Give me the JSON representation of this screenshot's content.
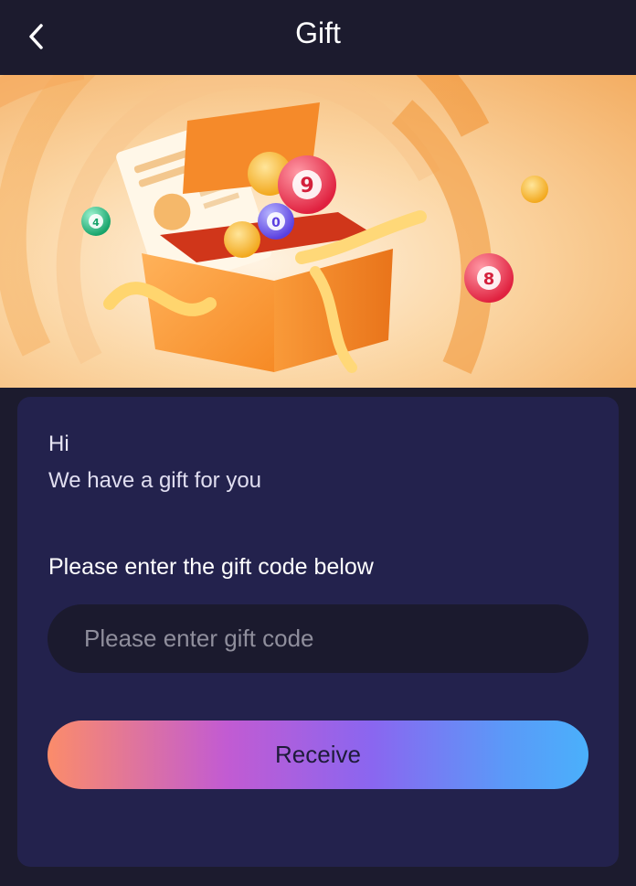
{
  "header": {
    "title": "Gift",
    "back_icon": "chevron-left-icon"
  },
  "banner": {
    "image": "gift-box-banner",
    "balls": [
      "4",
      "9",
      "0",
      "8"
    ]
  },
  "card": {
    "greeting": "Hi",
    "message": "We have a gift for you",
    "prompt": "Please enter the gift code below",
    "input_placeholder": "Please enter gift code",
    "button_label": "Receive"
  },
  "colors": {
    "background": "#1c1b2e",
    "card": "#23224d",
    "input": "#1b1a2e",
    "gradient_start": "#fb8c6a",
    "gradient_end": "#4ab0fb"
  }
}
